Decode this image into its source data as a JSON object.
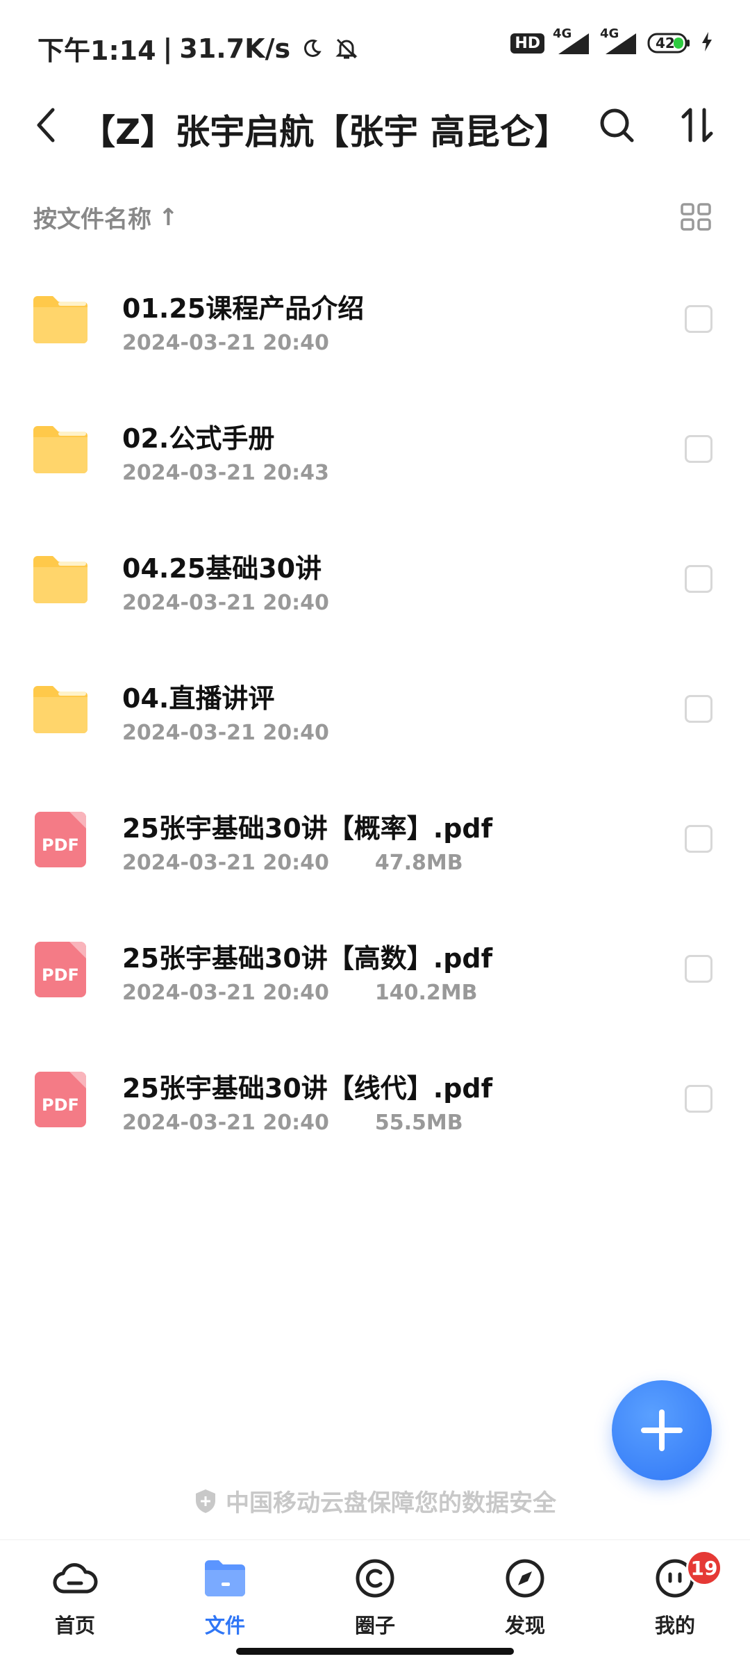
{
  "status_bar": {
    "time": "下午1:14",
    "net_speed": "31.7K/s",
    "hd_label": "HD",
    "net_1": "4G",
    "net_2": "4G",
    "battery": "42"
  },
  "header": {
    "title": "【Z】张宇启航【张宇 高昆仑】"
  },
  "sort_bar": {
    "label": "按文件名称",
    "direction_glyph": "↑"
  },
  "files": [
    {
      "name": "01.25课程产品介绍",
      "date": "2024-03-21 20:40",
      "size": "",
      "type": "folder"
    },
    {
      "name": "02.公式手册",
      "date": "2024-03-21 20:43",
      "size": "",
      "type": "folder"
    },
    {
      "name": "04.25基础30讲",
      "date": "2024-03-21 20:40",
      "size": "",
      "type": "folder"
    },
    {
      "name": "04.直播讲评",
      "date": "2024-03-21 20:40",
      "size": "",
      "type": "folder"
    },
    {
      "name": "25张宇基础30讲【概率】.pdf",
      "date": "2024-03-21 20:40",
      "size": "47.8MB",
      "type": "pdf"
    },
    {
      "name": "25张宇基础30讲【高数】.pdf",
      "date": "2024-03-21 20:40",
      "size": "140.2MB",
      "type": "pdf"
    },
    {
      "name": "25张宇基础30讲【线代】.pdf",
      "date": "2024-03-21 20:40",
      "size": "55.5MB",
      "type": "pdf"
    }
  ],
  "pdf_icon_label": "PDF",
  "security_note": "中国移动云盘保障您的数据安全",
  "bottom_nav": [
    {
      "label": "首页",
      "icon": "cloud-icon",
      "active": false
    },
    {
      "label": "文件",
      "icon": "folder-icon",
      "active": true
    },
    {
      "label": "圈子",
      "icon": "circle-icon",
      "active": false
    },
    {
      "label": "发现",
      "icon": "compass-icon",
      "active": false
    },
    {
      "label": "我的",
      "icon": "face-icon",
      "active": false,
      "badge": "19"
    }
  ],
  "colors": {
    "accent": "#2f76f6",
    "folder": "#ffcf5c",
    "pdf": "#f47b86",
    "badge": "#e53935"
  }
}
